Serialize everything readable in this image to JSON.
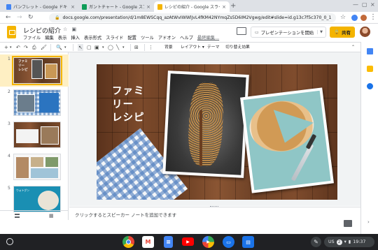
{
  "browser": {
    "tabs": [
      {
        "title": "パンフレット - Google ドキ",
        "favicon_color": "#4285f4",
        "active": false
      },
      {
        "title": "ガントチャート - Google スプ",
        "favicon_color": "#0f9d58",
        "active": false
      },
      {
        "title": "レシピの紹介 - Google スライ",
        "favicon_color": "#f4b400",
        "active": true
      }
    ],
    "url": "docs.google.com/presentation/d/1m8EWSCqq_azAtWvIWWlJvL4fKM42NYmqZs5D6IM2Vgwg/edit#slide=id.g13c7f5c370_0_1"
  },
  "slides_app": {
    "doc_title": "レシピの紹介",
    "menu": [
      "ファイル",
      "編集",
      "表示",
      "挿入",
      "表示形式",
      "スライド",
      "配置",
      "ツール",
      "アドオン",
      "ヘルプ"
    ],
    "last_edit": "最終編集...",
    "present_label": "プレゼンテーションを開始",
    "share_label": "共有",
    "toolbar_text": {
      "background": "背景",
      "layout": "レイアウト ▾",
      "theme": "テーマ",
      "transition": "切り替え効果"
    }
  },
  "filmstrip": {
    "slides": [
      {
        "num": "1",
        "label": "ファミ\nリー\nレシピ",
        "selected": true
      },
      {
        "num": "2",
        "label": "",
        "selected": false
      },
      {
        "num": "3",
        "label": "",
        "selected": false
      },
      {
        "num": "4",
        "label": "",
        "selected": false
      },
      {
        "num": "5",
        "label": "ウォトグン",
        "selected": false
      }
    ]
  },
  "slide": {
    "title": "ファミ\nリー\nレシピ"
  },
  "notes": {
    "placeholder": "クリックするとスピーカー ノートを追加できます"
  },
  "shelf": {
    "locale": "US",
    "notification_count": "2",
    "time": "19:37"
  },
  "colors": {
    "slides_yellow": "#f4b400",
    "selected_band": "#feefc3"
  }
}
